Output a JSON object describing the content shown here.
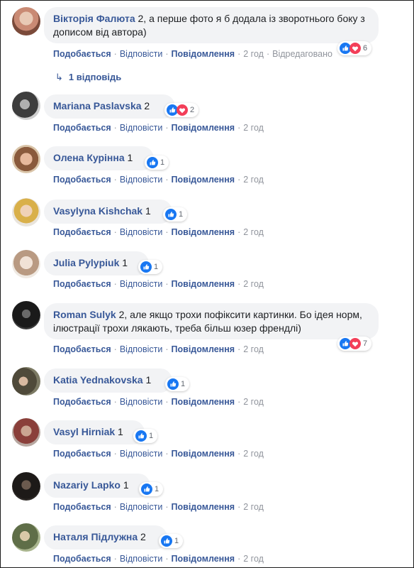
{
  "colors": {
    "link": "#385898",
    "meta": "#90949c",
    "bubble": "#f2f3f5",
    "like": "#1877f2",
    "love": "#f33e58"
  },
  "labels": {
    "like": "Подобається",
    "reply": "Відповісти",
    "message": "Повідомлення",
    "sep": "·"
  },
  "comments": [
    {
      "author": "Вікторія Фалюта",
      "text": " 2, а перше фото я б додала із зворотнього боку з дописом від автора)",
      "time": "2 год",
      "extra": "Відредаговано",
      "reactions": [
        "like-icon",
        "love-icon"
      ],
      "count": "6"
    },
    {
      "author": "Mariana Paslavska",
      "text": " 2",
      "time": "2 год",
      "reactions": [
        "like-icon",
        "love-icon"
      ],
      "count": "2"
    },
    {
      "author": "Олена Курінна",
      "text": " 1",
      "time": "2 год",
      "reactions": [
        "like-icon"
      ],
      "count": "1"
    },
    {
      "author": "Vasylyna Kishchak",
      "text": " 1",
      "time": "2 год",
      "reactions": [
        "like-icon"
      ],
      "count": "1"
    },
    {
      "author": "Julia Pylypiuk",
      "text": " 1",
      "time": "2 год",
      "reactions": [
        "like-icon"
      ],
      "count": "1"
    },
    {
      "author": "Roman Sulyk",
      "text": " 2, але якщо трохи пофіксити картинки. Бо ідея норм, ілюстрації трохи лякають, треба більш юзер френдлі)",
      "time": "2 год",
      "reactions": [
        "like-icon",
        "love-icon"
      ],
      "count": "7"
    },
    {
      "author": "Katia Yednakovska",
      "text": " 1",
      "time": "2 год",
      "reactions": [
        "like-icon"
      ],
      "count": "1"
    },
    {
      "author": "Vasyl Hirniak",
      "text": " 1",
      "time": "2 год",
      "reactions": [
        "like-icon"
      ],
      "count": "1"
    },
    {
      "author": "Nazariy Lapko",
      "text": " 1",
      "time": "2 год",
      "reactions": [
        "like-icon"
      ],
      "count": "1"
    },
    {
      "author": "Наталя Підлужна",
      "text": " 2",
      "time": "2 год",
      "reactions": [
        "like-icon"
      ],
      "count": "1"
    }
  ],
  "replies": {
    "label": "1 відповідь"
  }
}
